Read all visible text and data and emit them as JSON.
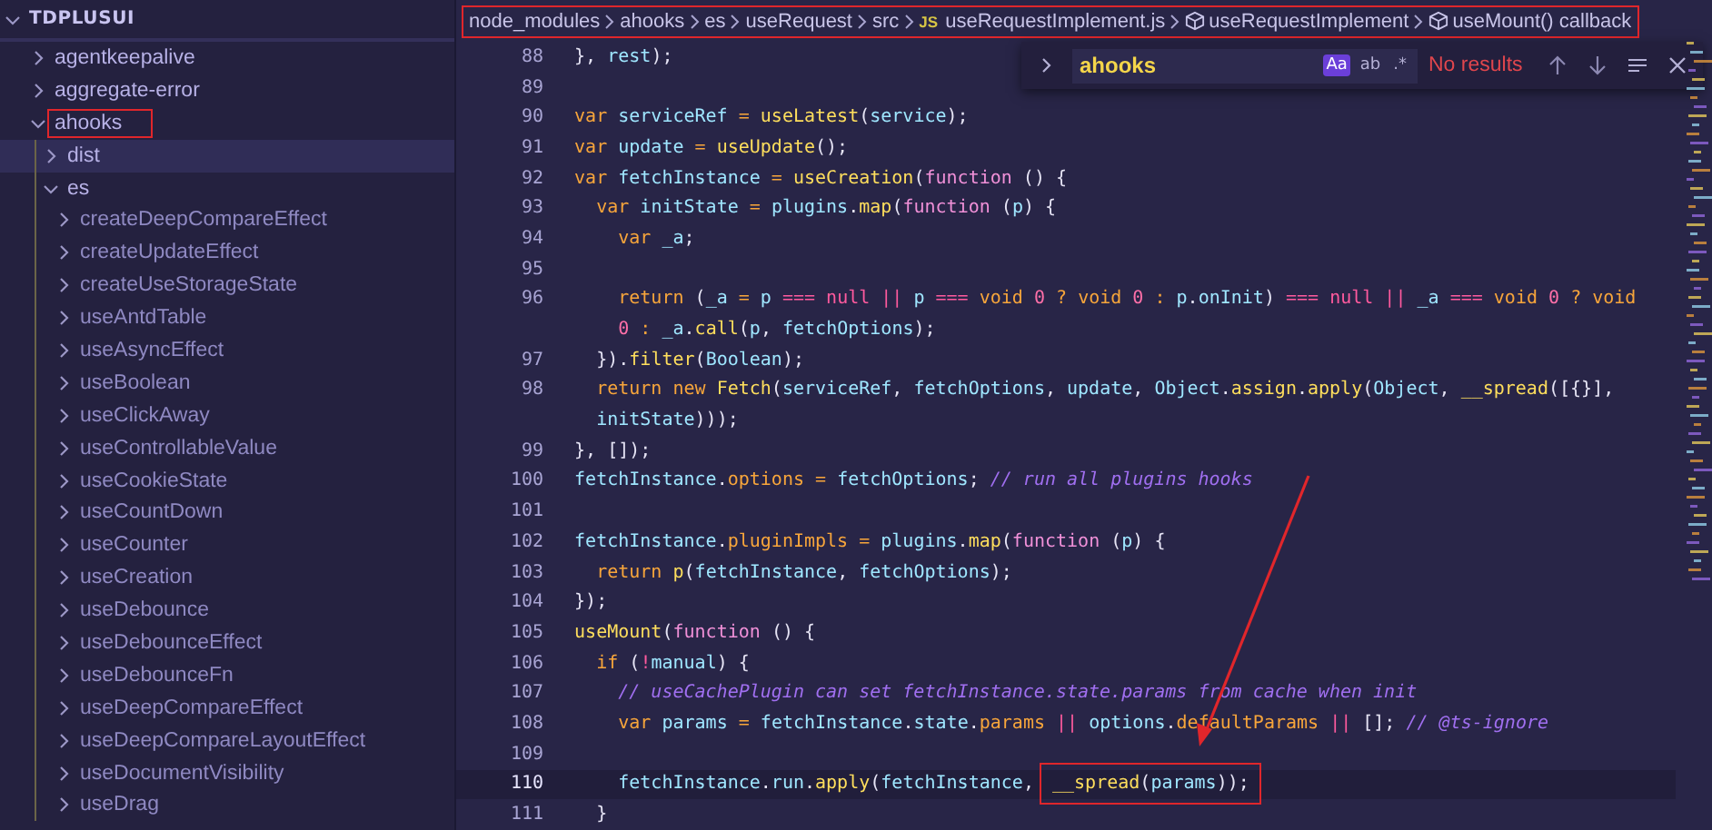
{
  "explorer": {
    "root": {
      "label": "TDPLUSUI",
      "expanded": true,
      "children": [
        {
          "label": "agentkeepalive",
          "expanded": false,
          "selected": false
        },
        {
          "label": "aggregate-error",
          "expanded": false,
          "selected": false
        },
        {
          "label": "ahooks",
          "expanded": true,
          "selected": false,
          "annotated": true,
          "children": [
            {
              "label": "dist",
              "expanded": false,
              "selected": true
            },
            {
              "label": "es",
              "expanded": true,
              "selected": false,
              "children": [
                {
                  "label": "createDeepCompareEffect",
                  "expanded": false,
                  "selected": false
                },
                {
                  "label": "createUpdateEffect",
                  "expanded": false,
                  "selected": false
                },
                {
                  "label": "createUseStorageState",
                  "expanded": false,
                  "selected": false
                },
                {
                  "label": "useAntdTable",
                  "expanded": false,
                  "selected": false
                },
                {
                  "label": "useAsyncEffect",
                  "expanded": false,
                  "selected": false
                },
                {
                  "label": "useBoolean",
                  "expanded": false,
                  "selected": false
                },
                {
                  "label": "useClickAway",
                  "expanded": false,
                  "selected": false
                },
                {
                  "label": "useControllableValue",
                  "expanded": false,
                  "selected": false
                },
                {
                  "label": "useCookieState",
                  "expanded": false,
                  "selected": false
                },
                {
                  "label": "useCountDown",
                  "expanded": false,
                  "selected": false
                },
                {
                  "label": "useCounter",
                  "expanded": false,
                  "selected": false
                },
                {
                  "label": "useCreation",
                  "expanded": false,
                  "selected": false
                },
                {
                  "label": "useDebounce",
                  "expanded": false,
                  "selected": false
                },
                {
                  "label": "useDebounceEffect",
                  "expanded": false,
                  "selected": false
                },
                {
                  "label": "useDebounceFn",
                  "expanded": false,
                  "selected": false
                },
                {
                  "label": "useDeepCompareEffect",
                  "expanded": false,
                  "selected": false
                },
                {
                  "label": "useDeepCompareLayoutEffect",
                  "expanded": false,
                  "selected": false
                },
                {
                  "label": "useDocumentVisibility",
                  "expanded": false,
                  "selected": false
                },
                {
                  "label": "useDrag",
                  "expanded": false,
                  "selected": false
                }
              ]
            }
          ]
        }
      ]
    }
  },
  "breadcrumbs": {
    "annotated": true,
    "items": [
      {
        "kind": "folder",
        "label": "node_modules"
      },
      {
        "kind": "folder",
        "label": "ahooks"
      },
      {
        "kind": "folder",
        "label": "es"
      },
      {
        "kind": "folder",
        "label": "useRequest"
      },
      {
        "kind": "folder",
        "label": "src"
      },
      {
        "kind": "file",
        "badge": "JS",
        "label": "useRequestImplement.js"
      },
      {
        "kind": "symbol",
        "label": "useRequestImplement"
      },
      {
        "kind": "symbol",
        "label": "useMount() callback"
      }
    ]
  },
  "find_widget": {
    "value": "ahooks",
    "options": [
      {
        "label": "Aa",
        "selected": true
      },
      {
        "label": "ab",
        "selected": false
      },
      {
        "label": ".*",
        "selected": false
      }
    ],
    "status": "No results"
  },
  "code": [
    {
      "number": "88",
      "tokens": [
        {
          "kind": "punct",
          "text": "  }, "
        },
        {
          "kind": "id",
          "text": "rest"
        },
        {
          "kind": "punct",
          "text": ");"
        }
      ]
    },
    {
      "number": "89"
    },
    {
      "number": "90",
      "tokens": [
        {
          "kind": "kw",
          "text": "  var "
        },
        {
          "kind": "id",
          "text": "serviceRef "
        },
        {
          "kind": "op",
          "text": "= "
        },
        {
          "kind": "fn",
          "text": "useLatest"
        },
        {
          "kind": "punct",
          "text": "("
        },
        {
          "kind": "id",
          "text": "service"
        },
        {
          "kind": "punct",
          "text": ");"
        }
      ]
    },
    {
      "number": "91",
      "tokens": [
        {
          "kind": "kw",
          "text": "  var "
        },
        {
          "kind": "id",
          "text": "update "
        },
        {
          "kind": "op",
          "text": "= "
        },
        {
          "kind": "fn",
          "text": "useUpdate"
        },
        {
          "kind": "punct",
          "text": "();"
        }
      ]
    },
    {
      "number": "92",
      "tokens": [
        {
          "kind": "kw",
          "text": "  var "
        },
        {
          "kind": "id",
          "text": "fetchInstance "
        },
        {
          "kind": "op",
          "text": "= "
        },
        {
          "kind": "fn",
          "text": "useCreation"
        },
        {
          "kind": "punct",
          "text": "("
        },
        {
          "kind": "kw2",
          "text": "function "
        },
        {
          "kind": "punct",
          "text": "() {"
        }
      ]
    },
    {
      "number": "93",
      "tokens": [
        {
          "kind": "kw",
          "text": "    var "
        },
        {
          "kind": "id",
          "text": "initState "
        },
        {
          "kind": "op",
          "text": "= "
        },
        {
          "kind": "id",
          "text": "plugins"
        },
        {
          "kind": "punct",
          "text": "."
        },
        {
          "kind": "fn",
          "text": "map"
        },
        {
          "kind": "punct",
          "text": "("
        },
        {
          "kind": "kw2",
          "text": "function "
        },
        {
          "kind": "punct",
          "text": "("
        },
        {
          "kind": "id",
          "text": "p"
        },
        {
          "kind": "punct",
          "text": ") {"
        }
      ]
    },
    {
      "number": "94",
      "tokens": [
        {
          "kind": "kw",
          "text": "      var "
        },
        {
          "kind": "id",
          "text": "_a"
        },
        {
          "kind": "punct",
          "text": ";"
        }
      ]
    },
    {
      "number": "95"
    },
    {
      "number": "96",
      "tokens": [
        {
          "kind": "kw",
          "text": "      return "
        },
        {
          "kind": "punct",
          "text": "("
        },
        {
          "kind": "id",
          "text": "_a "
        },
        {
          "kind": "op",
          "text": "= "
        },
        {
          "kind": "id",
          "text": "p "
        },
        {
          "kind": "cmp",
          "text": "=== null || "
        },
        {
          "kind": "id",
          "text": "p "
        },
        {
          "kind": "cmp",
          "text": "=== "
        },
        {
          "kind": "kw",
          "text": "void "
        },
        {
          "kind": "num",
          "text": "0 "
        },
        {
          "kind": "op",
          "text": "? "
        },
        {
          "kind": "kw",
          "text": "void "
        },
        {
          "kind": "num",
          "text": "0 "
        },
        {
          "kind": "op",
          "text": ": "
        },
        {
          "kind": "id",
          "text": "p"
        },
        {
          "kind": "punct",
          "text": "."
        },
        {
          "kind": "id",
          "text": "onInit"
        },
        {
          "kind": "punct",
          "text": ") "
        },
        {
          "kind": "cmp",
          "text": "=== null || "
        },
        {
          "kind": "id",
          "text": "_a "
        },
        {
          "kind": "cmp",
          "text": "=== "
        },
        {
          "kind": "kw",
          "text": "void "
        },
        {
          "kind": "num",
          "text": "0 "
        },
        {
          "kind": "op",
          "text": "? "
        },
        {
          "kind": "kw",
          "text": "void"
        }
      ]
    },
    {
      "tokens": [
        {
          "kind": "num",
          "text": "      0 "
        },
        {
          "kind": "op",
          "text": ": "
        },
        {
          "kind": "id",
          "text": "_a"
        },
        {
          "kind": "punct",
          "text": "."
        },
        {
          "kind": "fn",
          "text": "call"
        },
        {
          "kind": "punct",
          "text": "("
        },
        {
          "kind": "id",
          "text": "p"
        },
        {
          "kind": "punct",
          "text": ", "
        },
        {
          "kind": "id",
          "text": "fetchOptions"
        },
        {
          "kind": "punct",
          "text": ");"
        }
      ]
    },
    {
      "number": "97",
      "tokens": [
        {
          "kind": "punct",
          "text": "    })."
        },
        {
          "kind": "fn",
          "text": "filter"
        },
        {
          "kind": "punct",
          "text": "("
        },
        {
          "kind": "id",
          "text": "Boolean"
        },
        {
          "kind": "punct",
          "text": ");"
        }
      ]
    },
    {
      "number": "98",
      "tokens": [
        {
          "kind": "kw",
          "text": "    return new "
        },
        {
          "kind": "fn",
          "text": "Fetch"
        },
        {
          "kind": "punct",
          "text": "("
        },
        {
          "kind": "id",
          "text": "serviceRef"
        },
        {
          "kind": "punct",
          "text": ", "
        },
        {
          "kind": "id",
          "text": "fetchOptions"
        },
        {
          "kind": "punct",
          "text": ", "
        },
        {
          "kind": "id",
          "text": "update"
        },
        {
          "kind": "punct",
          "text": ", "
        },
        {
          "kind": "id",
          "text": "Object"
        },
        {
          "kind": "punct",
          "text": "."
        },
        {
          "kind": "fn",
          "text": "assign"
        },
        {
          "kind": "punct",
          "text": "."
        },
        {
          "kind": "fn",
          "text": "apply"
        },
        {
          "kind": "punct",
          "text": "("
        },
        {
          "kind": "id",
          "text": "Object"
        },
        {
          "kind": "punct",
          "text": ", "
        },
        {
          "kind": "fn",
          "text": "__spread"
        },
        {
          "kind": "punct",
          "text": "([{}],"
        }
      ]
    },
    {
      "tokens": [
        {
          "kind": "id",
          "text": "    initState"
        },
        {
          "kind": "punct",
          "text": ")));"
        }
      ]
    },
    {
      "number": "99",
      "tokens": [
        {
          "kind": "punct",
          "text": "  }, []);"
        }
      ]
    },
    {
      "number": "100",
      "tokens": [
        {
          "kind": "id",
          "text": "  fetchInstance"
        },
        {
          "kind": "punct",
          "text": "."
        },
        {
          "kind": "prop",
          "text": "options "
        },
        {
          "kind": "op",
          "text": "= "
        },
        {
          "kind": "id",
          "text": "fetchOptions"
        },
        {
          "kind": "punct",
          "text": "; "
        },
        {
          "kind": "comment",
          "text": "// run all plugins hooks"
        }
      ]
    },
    {
      "number": "101"
    },
    {
      "number": "102",
      "tokens": [
        {
          "kind": "id",
          "text": "  fetchInstance"
        },
        {
          "kind": "punct",
          "text": "."
        },
        {
          "kind": "prop",
          "text": "pluginImpls "
        },
        {
          "kind": "op",
          "text": "= "
        },
        {
          "kind": "id",
          "text": "plugins"
        },
        {
          "kind": "punct",
          "text": "."
        },
        {
          "kind": "fn",
          "text": "map"
        },
        {
          "kind": "punct",
          "text": "("
        },
        {
          "kind": "kw2",
          "text": "function "
        },
        {
          "kind": "punct",
          "text": "("
        },
        {
          "kind": "id",
          "text": "p"
        },
        {
          "kind": "punct",
          "text": ") {"
        }
      ]
    },
    {
      "number": "103",
      "tokens": [
        {
          "kind": "kw",
          "text": "    return "
        },
        {
          "kind": "fn",
          "text": "p"
        },
        {
          "kind": "punct",
          "text": "("
        },
        {
          "kind": "id",
          "text": "fetchInstance"
        },
        {
          "kind": "punct",
          "text": ", "
        },
        {
          "kind": "id",
          "text": "fetchOptions"
        },
        {
          "kind": "punct",
          "text": ");"
        }
      ]
    },
    {
      "number": "104",
      "tokens": [
        {
          "kind": "punct",
          "text": "  });"
        }
      ]
    },
    {
      "number": "105",
      "tokens": [
        {
          "kind": "fn",
          "text": "  useMount"
        },
        {
          "kind": "punct",
          "text": "("
        },
        {
          "kind": "kw2",
          "text": "function "
        },
        {
          "kind": "punct",
          "text": "() {"
        }
      ]
    },
    {
      "number": "106",
      "tokens": [
        {
          "kind": "kw",
          "text": "    if "
        },
        {
          "kind": "punct",
          "text": "("
        },
        {
          "kind": "cmp",
          "text": "!"
        },
        {
          "kind": "id",
          "text": "manual"
        },
        {
          "kind": "punct",
          "text": ") {"
        }
      ]
    },
    {
      "number": "107",
      "tokens": [
        {
          "kind": "comment",
          "text": "      // useCachePlugin can set fetchInstance.state.params from cache when init"
        }
      ]
    },
    {
      "number": "108",
      "tokens": [
        {
          "kind": "kw",
          "text": "      var "
        },
        {
          "kind": "id",
          "text": "params "
        },
        {
          "kind": "op",
          "text": "= "
        },
        {
          "kind": "id",
          "text": "fetchInstance"
        },
        {
          "kind": "punct",
          "text": "."
        },
        {
          "kind": "id",
          "text": "state"
        },
        {
          "kind": "punct",
          "text": "."
        },
        {
          "kind": "prop",
          "text": "params "
        },
        {
          "kind": "cmp",
          "text": "|| "
        },
        {
          "kind": "id",
          "text": "options"
        },
        {
          "kind": "punct",
          "text": "."
        },
        {
          "kind": "prop",
          "text": "defaultParams "
        },
        {
          "kind": "cmp",
          "text": "|| "
        },
        {
          "kind": "punct",
          "text": "[]; "
        },
        {
          "kind": "comment",
          "text": "// @ts-ignore"
        }
      ]
    },
    {
      "number": "109"
    },
    {
      "number": "110",
      "current": true,
      "tokens": [
        {
          "kind": "id",
          "text": "      fetchInstance"
        },
        {
          "kind": "punct",
          "text": "."
        },
        {
          "kind": "id",
          "text": "run"
        },
        {
          "kind": "punct",
          "text": "."
        },
        {
          "kind": "fn",
          "text": "apply"
        },
        {
          "kind": "punct",
          "text": "("
        },
        {
          "kind": "id",
          "text": "fetchInstance"
        },
        {
          "kind": "punct",
          "text": ", "
        },
        {
          "kind": "fn",
          "text": "__spread",
          "boxed": true
        },
        {
          "kind": "punct",
          "text": "(",
          "boxed": true
        },
        {
          "kind": "id",
          "text": "params",
          "boxed": true
        },
        {
          "kind": "punct",
          "text": "));",
          "boxed": true
        }
      ]
    },
    {
      "number": "111",
      "tokens": [
        {
          "kind": "punct",
          "text": "    }"
        }
      ]
    }
  ]
}
